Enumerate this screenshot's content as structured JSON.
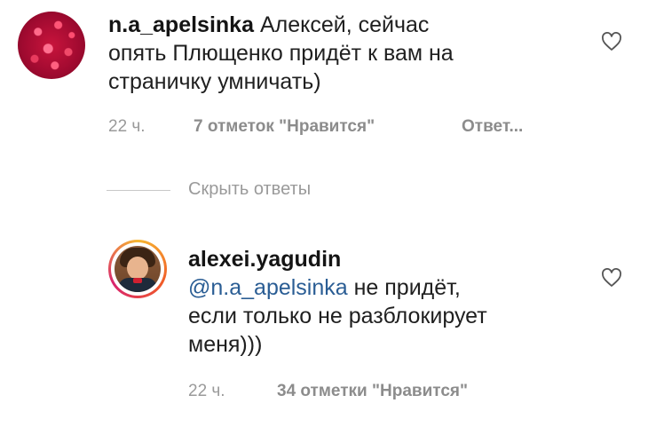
{
  "comments": [
    {
      "username": "n.a_apelsinka",
      "text_lines": [
        "Алексей, сейчас",
        "опять Плющенко придёт к вам на",
        "страничку умничать)"
      ],
      "time": "22 ч.",
      "likes": "7 отметок \"Нравится\"",
      "reply": "Ответ..."
    }
  ],
  "replies_toggle": "Скрыть ответы",
  "reply": {
    "username": "alexei.yagudin",
    "mention": "@n.a_apelsinka",
    "text_first": " не придёт,",
    "text_lines": [
      "если только не разблокирует",
      "меня)))"
    ],
    "time": "22 ч.",
    "likes": "34 отметки \"Нравится\""
  },
  "icons": {
    "like": "heart-outline-icon"
  }
}
